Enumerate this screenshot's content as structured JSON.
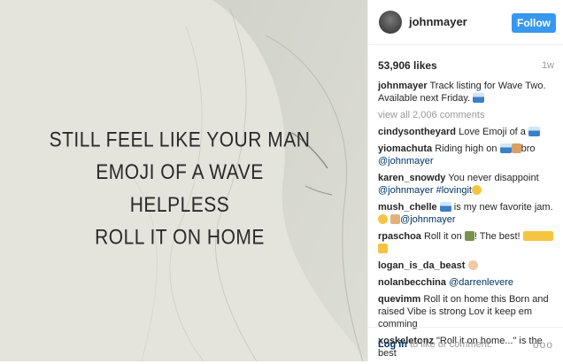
{
  "photo": {
    "lyrics": [
      "STILL FEEL LIKE YOUR MAN",
      "EMOJI OF A WAVE",
      "HELPLESS",
      "ROLL IT ON HOME"
    ]
  },
  "header": {
    "username": "johnmayer",
    "follow_label": "Follow"
  },
  "post": {
    "likes": "53,906 likes",
    "time": "1w",
    "caption_user": "johnmayer",
    "caption_text": "Track listing for Wave Two. Available next Friday.",
    "caption_emoji": "wave-emoji",
    "view_all": "view all 2,006 comments"
  },
  "comments": [
    {
      "user": "cindysontheyard",
      "text": "Love Emoji of a",
      "emoji": "wave-emoji"
    },
    {
      "user": "yiomachuta",
      "text": "Riding high on",
      "text2": "bro",
      "mention": "@johnmayer"
    },
    {
      "user": "karen_snowdy",
      "text": "You never disappoint",
      "mention": "@johnmayer",
      "hashtag": "#lovingit"
    },
    {
      "user": "mush_chelle",
      "text": "is my new favorite jam.",
      "mention": "@johnmayer"
    },
    {
      "user": "rpaschoa",
      "text": "Roll it on",
      "text2": "! The best!"
    },
    {
      "user": "logan_is_da_beast"
    },
    {
      "user": "nolanbecchina",
      "mention": "@darrenlevere"
    },
    {
      "user": "quevimm",
      "text": "Roll it on home this Born and raised Vibe is strong Lov it keep em comming"
    },
    {
      "user": "xoskeletonz",
      "text": "\"Roll it on home...\" is the best"
    }
  ],
  "footer": {
    "login_link": "Log in",
    "login_rest": "to like or comment.",
    "more": "ooo"
  },
  "colors": {
    "follow_bg": "#3897f0",
    "link": "#003569",
    "muted": "#999999"
  }
}
